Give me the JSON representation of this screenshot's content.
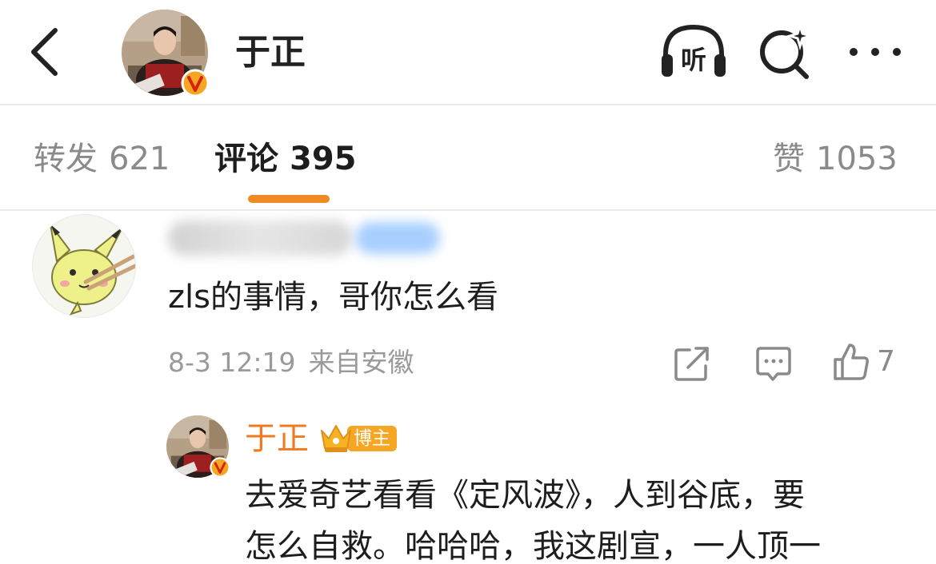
{
  "header": {
    "title": "于正",
    "listen_label": "听"
  },
  "tabs": [
    {
      "label": "转发",
      "count": "621"
    },
    {
      "label": "评论",
      "count": "395"
    },
    {
      "label": "赞",
      "count": "1053"
    }
  ],
  "comment": {
    "text": "zls的事情，哥你怎么看",
    "time": "8-3 12:19",
    "location": "来自安徽",
    "likes": "7"
  },
  "reply": {
    "user": "于正",
    "badge": "博主",
    "line1": "去爱奇艺看看《定风波》，人到谷底，要",
    "line2": "怎么自救。哈哈哈，我这剧宣，一人顶一"
  },
  "colors": {
    "accent": "#f08a24",
    "reply_name": "#f07a20",
    "badge": "#f6a623",
    "verified": "#f5a623",
    "muted_text": "#9a9a9a"
  },
  "icons": {
    "back": "chevron-left-icon",
    "listen": "headphones-icon",
    "search": "search-sparkle-icon",
    "more": "more-dots-icon",
    "share": "share-icon",
    "reply": "comment-icon",
    "like": "thumbs-up-icon",
    "verified": "verified-badge-icon",
    "crown": "crown-icon"
  }
}
